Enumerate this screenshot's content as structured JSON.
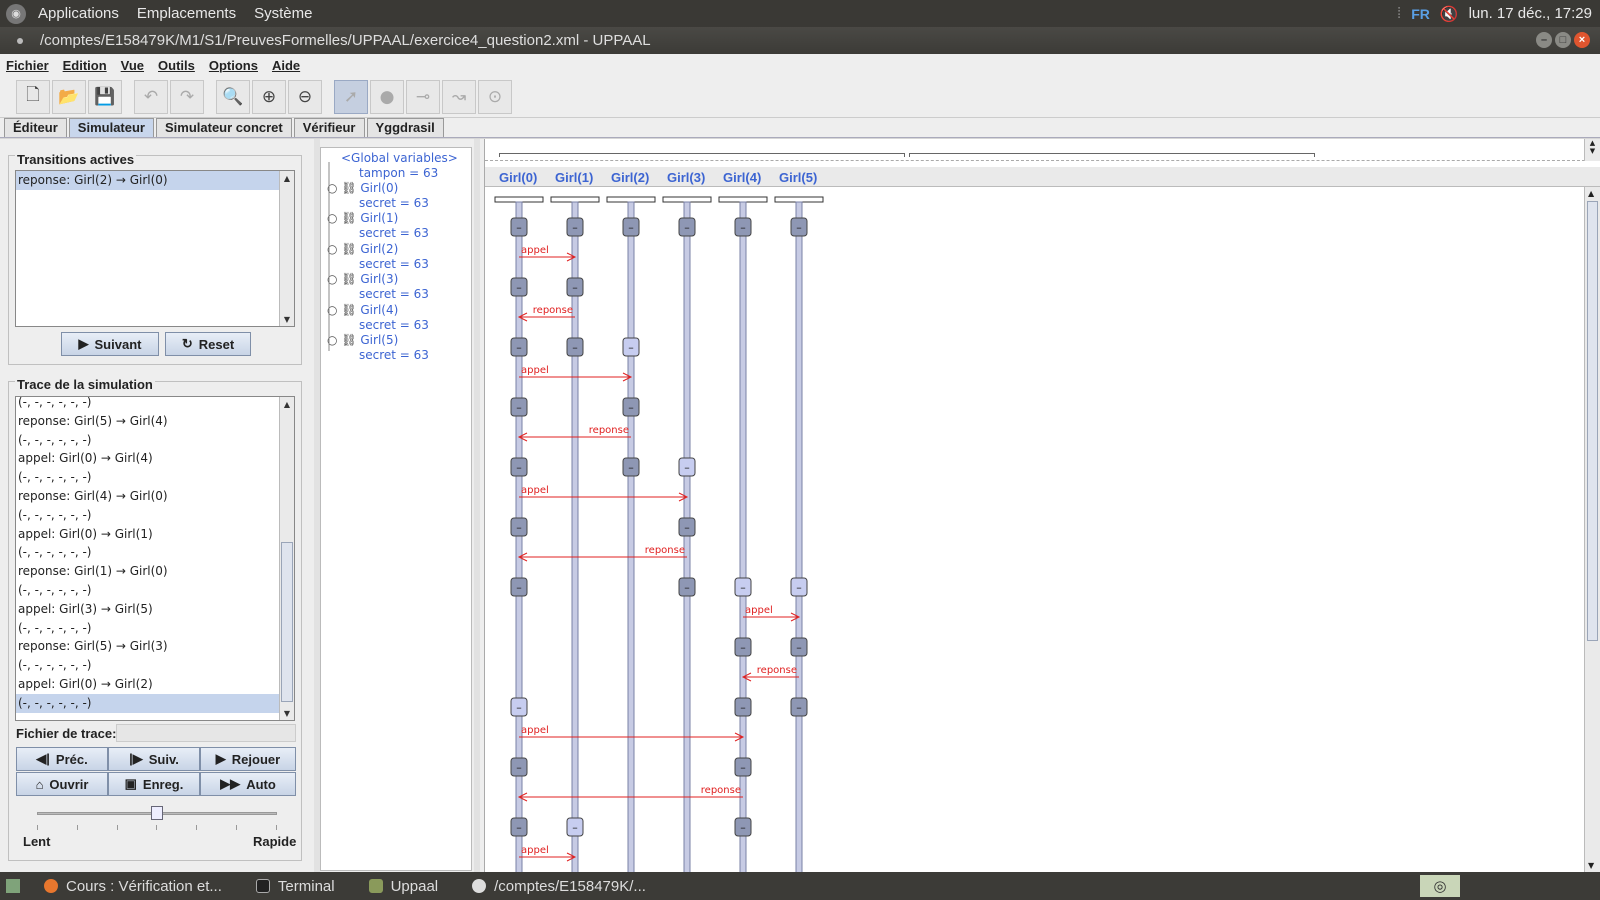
{
  "topbar": {
    "menus": [
      "Applications",
      "Emplacements",
      "Système"
    ],
    "lang": "FR",
    "clock": "lun. 17 déc., 17:29"
  },
  "window": {
    "title": "/comptes/E158479K/M1/S1/PreuvesFormelles/UPPAAL/exercice4_question2.xml - UPPAAL"
  },
  "menubar": [
    "Fichier",
    "Edition",
    "Vue",
    "Outils",
    "Options",
    "Aide"
  ],
  "tabs": [
    "Éditeur",
    "Simulateur",
    "Simulateur concret",
    "Vérifieur",
    "Yggdrasil"
  ],
  "transitions": {
    "title": "Transitions actives",
    "items": [
      "reponse: Girl(2) → Girl(0)"
    ],
    "next_label": "Suivant",
    "reset_label": "Reset"
  },
  "trace": {
    "title": "Trace de la simulation",
    "items": [
      "(-, -, -, -, -, -)",
      "reponse: Girl(5) → Girl(4)",
      "(-, -, -, -, -, -)",
      "appel: Girl(0) → Girl(4)",
      "(-, -, -, -, -, -)",
      "reponse: Girl(4) → Girl(0)",
      "(-, -, -, -, -, -)",
      "appel: Girl(0) → Girl(1)",
      "(-, -, -, -, -, -)",
      "reponse: Girl(1) → Girl(0)",
      "(-, -, -, -, -, -)",
      "appel: Girl(3) → Girl(5)",
      "(-, -, -, -, -, -)",
      "reponse: Girl(5) → Girl(3)",
      "(-, -, -, -, -, -)",
      "appel: Girl(0) → Girl(2)",
      "(-, -, -, -, -, -)"
    ],
    "file_label": "Fichier de trace:",
    "buttons": [
      "Préc.",
      "Suiv.",
      "Rejouer",
      "Ouvrir",
      "Enreg.",
      "Auto"
    ],
    "speed_slow": "Lent",
    "speed_fast": "Rapide",
    "speed_level": 0.5
  },
  "variables": {
    "root": "<Global variables>",
    "tampon": "tampon = 63",
    "processes": [
      {
        "name": "Girl(0)",
        "value": "secret = 63"
      },
      {
        "name": "Girl(1)",
        "value": "secret = 63"
      },
      {
        "name": "Girl(2)",
        "value": "secret = 63"
      },
      {
        "name": "Girl(3)",
        "value": "secret = 63"
      },
      {
        "name": "Girl(4)",
        "value": "secret = 63"
      },
      {
        "name": "Girl(5)",
        "value": "secret = 63"
      }
    ]
  },
  "msc": {
    "processes": [
      "Girl(0)",
      "Girl(1)",
      "Girl(2)",
      "Girl(3)",
      "Girl(4)",
      "Girl(5)"
    ],
    "state_symbol": "–",
    "messages": [
      {
        "label": "appel",
        "from": 0,
        "to": 1
      },
      {
        "label": "reponse",
        "from": 1,
        "to": 0
      },
      {
        "label": "appel",
        "from": 0,
        "to": 2
      },
      {
        "label": "reponse",
        "from": 2,
        "to": 0
      },
      {
        "label": "appel",
        "from": 0,
        "to": 3
      },
      {
        "label": "reponse",
        "from": 3,
        "to": 0
      },
      {
        "label": "appel",
        "from": 4,
        "to": 5
      },
      {
        "label": "reponse",
        "from": 5,
        "to": 4
      },
      {
        "label": "appel",
        "from": 0,
        "to": 4
      },
      {
        "label": "reponse",
        "from": 4,
        "to": 0
      },
      {
        "label": "appel",
        "from": 0,
        "to": 1
      }
    ],
    "colors": {
      "process": "#3c64d2",
      "message": "#e02020",
      "node": "#8e97b4",
      "node_active": "#c7cdf0"
    }
  },
  "taskbar": {
    "items": [
      "Cours : Vérification et...",
      "Terminal",
      "Uppaal",
      "/comptes/E158479K/..."
    ]
  }
}
